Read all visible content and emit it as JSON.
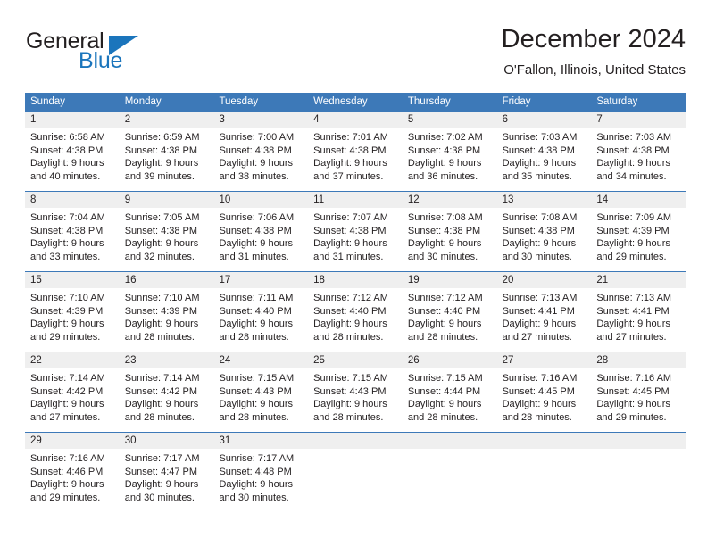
{
  "logo": {
    "word_top": "General",
    "word_bottom": "Blue",
    "triangle_icon": "triangle-icon",
    "brand_color": "#1b75bc"
  },
  "header": {
    "title": "December 2024",
    "subtitle": "O'Fallon, Illinois, United States"
  },
  "calendar": {
    "header_color": "#3d79b8",
    "daynum_band_color": "#efefef",
    "weekdays": [
      "Sunday",
      "Monday",
      "Tuesday",
      "Wednesday",
      "Thursday",
      "Friday",
      "Saturday"
    ],
    "weeks": [
      [
        {
          "day": "1",
          "sunrise": "Sunrise: 6:58 AM",
          "sunset": "Sunset: 4:38 PM",
          "daylight1": "Daylight: 9 hours",
          "daylight2": "and 40 minutes."
        },
        {
          "day": "2",
          "sunrise": "Sunrise: 6:59 AM",
          "sunset": "Sunset: 4:38 PM",
          "daylight1": "Daylight: 9 hours",
          "daylight2": "and 39 minutes."
        },
        {
          "day": "3",
          "sunrise": "Sunrise: 7:00 AM",
          "sunset": "Sunset: 4:38 PM",
          "daylight1": "Daylight: 9 hours",
          "daylight2": "and 38 minutes."
        },
        {
          "day": "4",
          "sunrise": "Sunrise: 7:01 AM",
          "sunset": "Sunset: 4:38 PM",
          "daylight1": "Daylight: 9 hours",
          "daylight2": "and 37 minutes."
        },
        {
          "day": "5",
          "sunrise": "Sunrise: 7:02 AM",
          "sunset": "Sunset: 4:38 PM",
          "daylight1": "Daylight: 9 hours",
          "daylight2": "and 36 minutes."
        },
        {
          "day": "6",
          "sunrise": "Sunrise: 7:03 AM",
          "sunset": "Sunset: 4:38 PM",
          "daylight1": "Daylight: 9 hours",
          "daylight2": "and 35 minutes."
        },
        {
          "day": "7",
          "sunrise": "Sunrise: 7:03 AM",
          "sunset": "Sunset: 4:38 PM",
          "daylight1": "Daylight: 9 hours",
          "daylight2": "and 34 minutes."
        }
      ],
      [
        {
          "day": "8",
          "sunrise": "Sunrise: 7:04 AM",
          "sunset": "Sunset: 4:38 PM",
          "daylight1": "Daylight: 9 hours",
          "daylight2": "and 33 minutes."
        },
        {
          "day": "9",
          "sunrise": "Sunrise: 7:05 AM",
          "sunset": "Sunset: 4:38 PM",
          "daylight1": "Daylight: 9 hours",
          "daylight2": "and 32 minutes."
        },
        {
          "day": "10",
          "sunrise": "Sunrise: 7:06 AM",
          "sunset": "Sunset: 4:38 PM",
          "daylight1": "Daylight: 9 hours",
          "daylight2": "and 31 minutes."
        },
        {
          "day": "11",
          "sunrise": "Sunrise: 7:07 AM",
          "sunset": "Sunset: 4:38 PM",
          "daylight1": "Daylight: 9 hours",
          "daylight2": "and 31 minutes."
        },
        {
          "day": "12",
          "sunrise": "Sunrise: 7:08 AM",
          "sunset": "Sunset: 4:38 PM",
          "daylight1": "Daylight: 9 hours",
          "daylight2": "and 30 minutes."
        },
        {
          "day": "13",
          "sunrise": "Sunrise: 7:08 AM",
          "sunset": "Sunset: 4:38 PM",
          "daylight1": "Daylight: 9 hours",
          "daylight2": "and 30 minutes."
        },
        {
          "day": "14",
          "sunrise": "Sunrise: 7:09 AM",
          "sunset": "Sunset: 4:39 PM",
          "daylight1": "Daylight: 9 hours",
          "daylight2": "and 29 minutes."
        }
      ],
      [
        {
          "day": "15",
          "sunrise": "Sunrise: 7:10 AM",
          "sunset": "Sunset: 4:39 PM",
          "daylight1": "Daylight: 9 hours",
          "daylight2": "and 29 minutes."
        },
        {
          "day": "16",
          "sunrise": "Sunrise: 7:10 AM",
          "sunset": "Sunset: 4:39 PM",
          "daylight1": "Daylight: 9 hours",
          "daylight2": "and 28 minutes."
        },
        {
          "day": "17",
          "sunrise": "Sunrise: 7:11 AM",
          "sunset": "Sunset: 4:40 PM",
          "daylight1": "Daylight: 9 hours",
          "daylight2": "and 28 minutes."
        },
        {
          "day": "18",
          "sunrise": "Sunrise: 7:12 AM",
          "sunset": "Sunset: 4:40 PM",
          "daylight1": "Daylight: 9 hours",
          "daylight2": "and 28 minutes."
        },
        {
          "day": "19",
          "sunrise": "Sunrise: 7:12 AM",
          "sunset": "Sunset: 4:40 PM",
          "daylight1": "Daylight: 9 hours",
          "daylight2": "and 28 minutes."
        },
        {
          "day": "20",
          "sunrise": "Sunrise: 7:13 AM",
          "sunset": "Sunset: 4:41 PM",
          "daylight1": "Daylight: 9 hours",
          "daylight2": "and 27 minutes."
        },
        {
          "day": "21",
          "sunrise": "Sunrise: 7:13 AM",
          "sunset": "Sunset: 4:41 PM",
          "daylight1": "Daylight: 9 hours",
          "daylight2": "and 27 minutes."
        }
      ],
      [
        {
          "day": "22",
          "sunrise": "Sunrise: 7:14 AM",
          "sunset": "Sunset: 4:42 PM",
          "daylight1": "Daylight: 9 hours",
          "daylight2": "and 27 minutes."
        },
        {
          "day": "23",
          "sunrise": "Sunrise: 7:14 AM",
          "sunset": "Sunset: 4:42 PM",
          "daylight1": "Daylight: 9 hours",
          "daylight2": "and 28 minutes."
        },
        {
          "day": "24",
          "sunrise": "Sunrise: 7:15 AM",
          "sunset": "Sunset: 4:43 PM",
          "daylight1": "Daylight: 9 hours",
          "daylight2": "and 28 minutes."
        },
        {
          "day": "25",
          "sunrise": "Sunrise: 7:15 AM",
          "sunset": "Sunset: 4:43 PM",
          "daylight1": "Daylight: 9 hours",
          "daylight2": "and 28 minutes."
        },
        {
          "day": "26",
          "sunrise": "Sunrise: 7:15 AM",
          "sunset": "Sunset: 4:44 PM",
          "daylight1": "Daylight: 9 hours",
          "daylight2": "and 28 minutes."
        },
        {
          "day": "27",
          "sunrise": "Sunrise: 7:16 AM",
          "sunset": "Sunset: 4:45 PM",
          "daylight1": "Daylight: 9 hours",
          "daylight2": "and 28 minutes."
        },
        {
          "day": "28",
          "sunrise": "Sunrise: 7:16 AM",
          "sunset": "Sunset: 4:45 PM",
          "daylight1": "Daylight: 9 hours",
          "daylight2": "and 29 minutes."
        }
      ],
      [
        {
          "day": "29",
          "sunrise": "Sunrise: 7:16 AM",
          "sunset": "Sunset: 4:46 PM",
          "daylight1": "Daylight: 9 hours",
          "daylight2": "and 29 minutes."
        },
        {
          "day": "30",
          "sunrise": "Sunrise: 7:17 AM",
          "sunset": "Sunset: 4:47 PM",
          "daylight1": "Daylight: 9 hours",
          "daylight2": "and 30 minutes."
        },
        {
          "day": "31",
          "sunrise": "Sunrise: 7:17 AM",
          "sunset": "Sunset: 4:48 PM",
          "daylight1": "Daylight: 9 hours",
          "daylight2": "and 30 minutes."
        },
        {
          "day": "",
          "sunrise": "",
          "sunset": "",
          "daylight1": "",
          "daylight2": ""
        },
        {
          "day": "",
          "sunrise": "",
          "sunset": "",
          "daylight1": "",
          "daylight2": ""
        },
        {
          "day": "",
          "sunrise": "",
          "sunset": "",
          "daylight1": "",
          "daylight2": ""
        },
        {
          "day": "",
          "sunrise": "",
          "sunset": "",
          "daylight1": "",
          "daylight2": ""
        }
      ]
    ]
  }
}
